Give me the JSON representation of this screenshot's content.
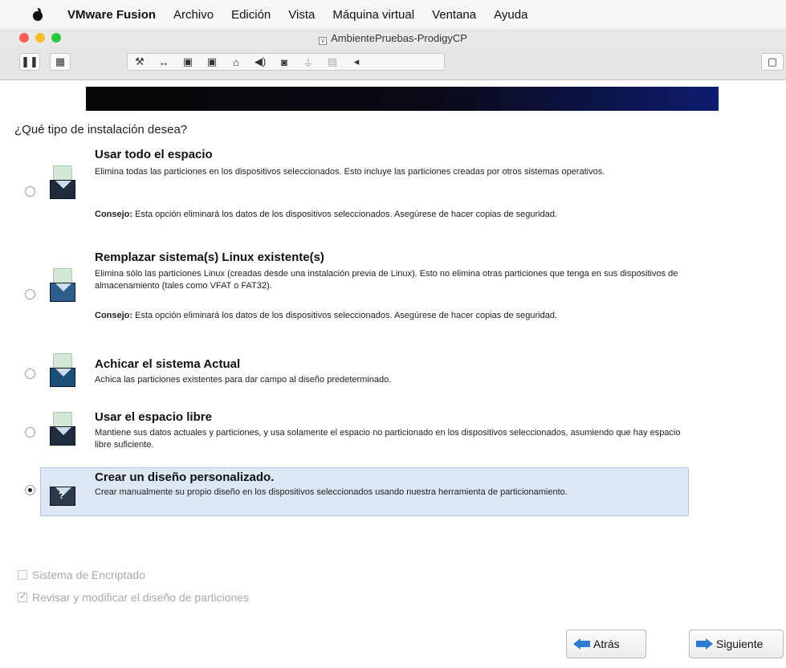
{
  "menubar": {
    "apple_icon": "apple-icon",
    "app": "VMware Fusion",
    "items": [
      "Archivo",
      "Edición",
      "Vista",
      "Máquina virtual",
      "Ventana",
      "Ayuda"
    ]
  },
  "window": {
    "title": "AmbientePruebas-ProdigyCP"
  },
  "toolbar": {
    "icons": [
      "pause-icon",
      "snapshot-icon",
      "settings-wrench-icon",
      "resize-arrows-icon",
      "disk-icon",
      "disk-2-icon",
      "printer-icon",
      "audio-icon",
      "camera-icon",
      "usb-icon",
      "network-icon",
      "more-chevron-icon",
      "fullscreen-icon"
    ]
  },
  "installer": {
    "question": "¿Qué tipo de instalación desea?",
    "options": [
      {
        "title": "Usar todo el espacio",
        "desc": "Elimina todas las particiones en los dispositivos seleccionados. Esto incluye las particiones creadas por otros sistemas operativos.",
        "tip_label": "Consejo:",
        "tip": " Esta opción eliminará los datos de los dispositivos seleccionados. Asegúrese de hacer copias de seguridad."
      },
      {
        "title": "Remplazar sistema(s) Linux existente(s)",
        "desc": "Elimina sólo las particiones Linux (creadas desde una instalación previa de Linux). Esto no elimina otras particiones que tenga en sus dispositivos de almacenamiento (tales como VFAT o FAT32).",
        "tip_label": "Consejo:",
        "tip": " Esta opción eliminará los datos de los dispositivos seleccionados. Asegúrese de hacer copias de seguridad."
      },
      {
        "title": "Achicar el sistema Actual",
        "desc": "Achica las particiones existentes para dar campo al diseño predeterminado."
      },
      {
        "title": "Usar el espacio libre",
        "desc": "Mantiene sus datos actuales y particiones, y usa solamente el espacio no particionado en los dispositivos seleccionados, asumiendo que hay espacio libre suficiente."
      },
      {
        "title": "Crear un diseño personalizado.",
        "desc": "Crear manualmente su propio diseño en los dispositivos seleccionados usando nuestra herramienta de particionamiento.",
        "selected": true
      }
    ],
    "checkboxes": [
      {
        "label": "Sistema de Encriptado",
        "checked": false,
        "enabled": false
      },
      {
        "label": "Revisar y modificar el diseño de particiones",
        "checked": true,
        "enabled": false
      }
    ],
    "buttons": {
      "back": "Atrás",
      "next": "Siguiente"
    },
    "accent_color": "#2d7ad0"
  }
}
